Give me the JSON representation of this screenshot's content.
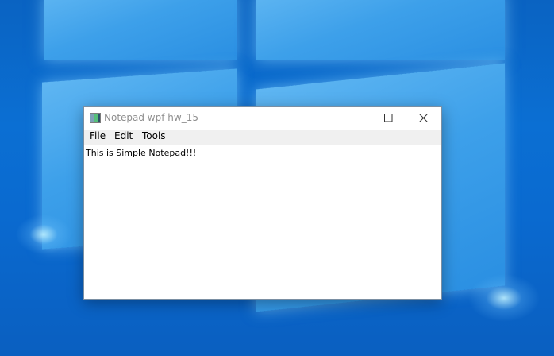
{
  "window": {
    "title": "Notepad wpf hw_15",
    "icon": "notepad-app-icon"
  },
  "caption_buttons": {
    "minimize": "minimize-icon",
    "maximize": "maximize-icon",
    "close": "close-icon"
  },
  "menu": {
    "items": [
      "File",
      "Edit",
      "Tools"
    ]
  },
  "editor": {
    "content": "This is Simple Notepad!!!"
  },
  "colors": {
    "desktop_background": "#0b6fd3",
    "menubar_background": "#f0f0f0",
    "title_text": "#8f8f8f"
  }
}
